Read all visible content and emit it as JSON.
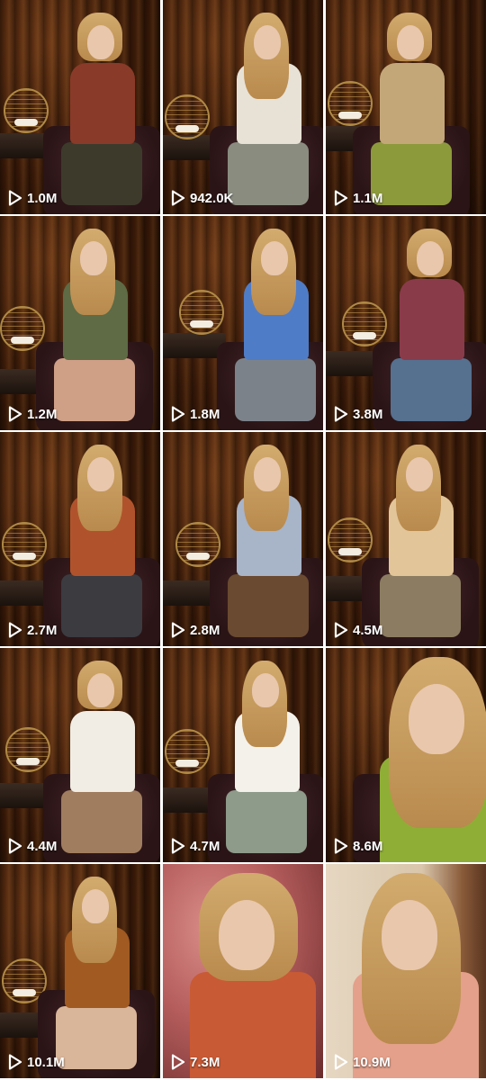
{
  "grid": {
    "videos": [
      {
        "views": "1.0M",
        "top": "#8a3a28",
        "bottom": "#3d3a2c",
        "bg": "curtain"
      },
      {
        "views": "942.0K",
        "top": "#e8e2d6",
        "bottom": "#8a8c80",
        "bg": "curtain"
      },
      {
        "views": "1.1M",
        "top": "#c4a779",
        "bottom": "#8d9a3c",
        "bg": "curtain"
      },
      {
        "views": "1.2M",
        "top": "#5e6b45",
        "bottom": "#cf9f86",
        "bg": "curtain"
      },
      {
        "views": "1.8M",
        "top": "#4f7cc7",
        "bottom": "#7c828a",
        "bg": "curtain"
      },
      {
        "views": "3.8M",
        "top": "#8a3b4a",
        "bottom": "#56708f",
        "bg": "curtain"
      },
      {
        "views": "2.7M",
        "top": "#b0532c",
        "bottom": "#3b3b40",
        "bg": "curtain"
      },
      {
        "views": "2.8M",
        "top": "#a8b4c8",
        "bottom": "#6a4a30",
        "bg": "curtain"
      },
      {
        "views": "4.5M",
        "top": "#e3c59a",
        "bottom": "#8c7d62",
        "bg": "curtain"
      },
      {
        "views": "4.4M",
        "top": "#f2ede4",
        "bottom": "#a07d5f",
        "bg": "curtain"
      },
      {
        "views": "4.7M",
        "top": "#f4f1ea",
        "bottom": "#8e9a8a",
        "bg": "curtain"
      },
      {
        "views": "8.6M",
        "top": "#8fae35",
        "bottom": "#d8b3a0",
        "bg": "curtain"
      },
      {
        "views": "10.1M",
        "top": "#a05a22",
        "bottom": "#d9b59a",
        "bg": "curtain"
      },
      {
        "views": "7.3M",
        "top": "#c85a35",
        "bottom": "#2a2a2a",
        "bg": "pink"
      },
      {
        "views": "10.9M",
        "top": "#e4a08a",
        "bottom": "#e4a08a",
        "bg": "wall"
      }
    ]
  },
  "icons": {
    "play": "play-outline-icon"
  },
  "colors": {
    "overlay_text": "#ffffff",
    "gap": "#ffffff"
  }
}
